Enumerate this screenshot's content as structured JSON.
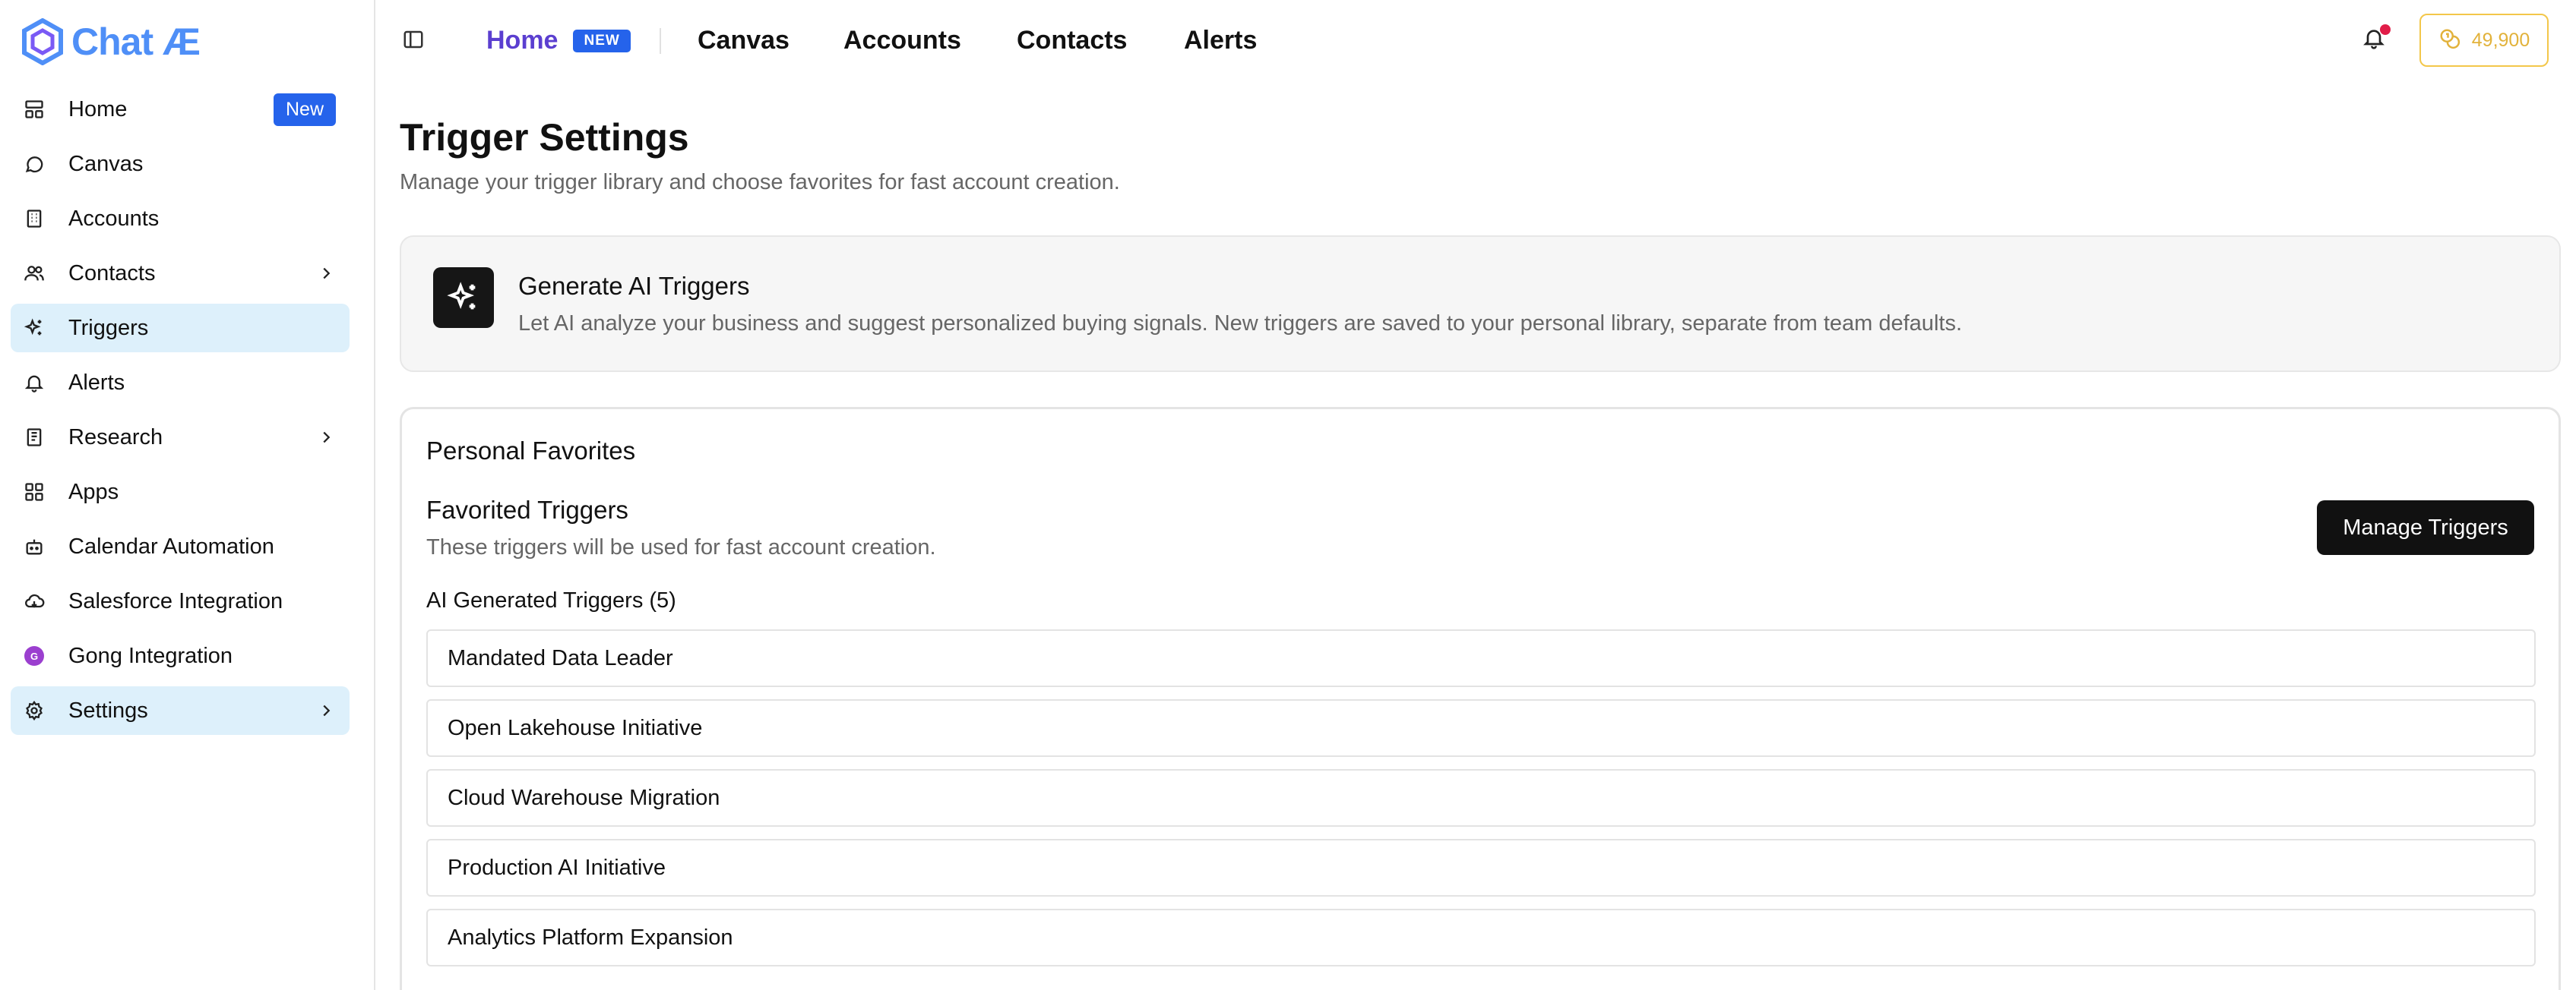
{
  "app": {
    "logo_text": "Chat Æ"
  },
  "sidebar": {
    "items": [
      {
        "label": "Home",
        "icon": "layout-icon",
        "badge": "New"
      },
      {
        "label": "Canvas",
        "icon": "chat-bubble-icon"
      },
      {
        "label": "Accounts",
        "icon": "building-icon"
      },
      {
        "label": "Contacts",
        "icon": "users-icon"
      },
      {
        "label": "Triggers",
        "icon": "sparkles-icon"
      },
      {
        "label": "Alerts",
        "icon": "bell-icon"
      },
      {
        "label": "Research",
        "icon": "book-icon"
      },
      {
        "label": "Apps",
        "icon": "grid-icon"
      },
      {
        "label": "Calendar Automation",
        "icon": "bot-icon"
      },
      {
        "label": "Salesforce Integration",
        "icon": "cloud-icon"
      },
      {
        "label": "Gong Integration",
        "icon": "gong-logo-icon",
        "icon_text": "G"
      },
      {
        "label": "Settings",
        "icon": "gear-icon"
      }
    ]
  },
  "topbar": {
    "home_label": "Home",
    "home_badge": "NEW",
    "links": [
      "Canvas",
      "Accounts",
      "Contacts",
      "Alerts"
    ],
    "credits": "49,900"
  },
  "page": {
    "title": "Trigger Settings",
    "subtitle": "Manage your trigger library and choose favorites for fast account creation."
  },
  "ai_card": {
    "title": "Generate AI Triggers",
    "description": "Let AI analyze your business and suggest personalized buying signals. New triggers are saved to your personal library, separate from team defaults."
  },
  "favorites": {
    "heading": "Personal Favorites",
    "sub_title": "Favorited Triggers",
    "sub_description": "These triggers will be used for fast account creation.",
    "manage_button": "Manage Triggers",
    "group_label": "AI Generated Triggers (5)",
    "triggers": [
      "Mandated Data Leader",
      "Open Lakehouse Initiative",
      "Cloud Warehouse Migration",
      "Production AI Initiative",
      "Analytics Platform Expansion"
    ]
  },
  "colors": {
    "brand": "#4f8ff7",
    "home_active": "#5b3fd0",
    "badge_blue": "#2563eb",
    "sidebar_active": "#ddf0fb",
    "credits_yellow": "#e2b23b",
    "notification_dot": "#e11d48"
  }
}
